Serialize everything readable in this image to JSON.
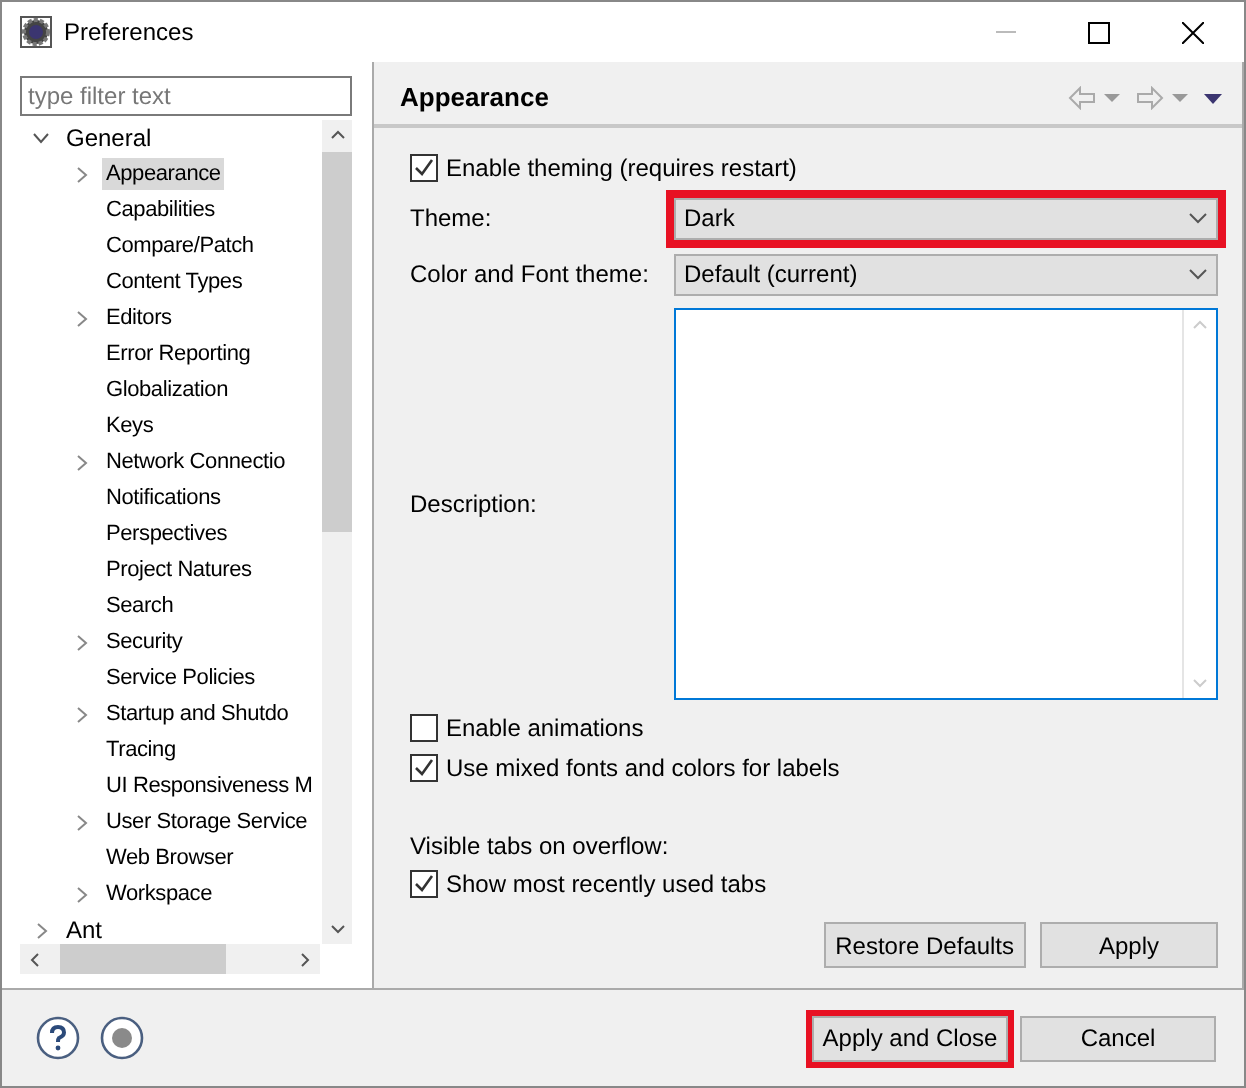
{
  "window": {
    "title": "Preferences"
  },
  "filter": {
    "placeholder": "type filter text"
  },
  "tree": [
    {
      "label": "General",
      "expanded": true,
      "expandable": true,
      "selected": false,
      "children": [
        {
          "label": "Appearance",
          "expandable": true,
          "selected": true
        },
        {
          "label": "Capabilities",
          "expandable": false,
          "selected": false
        },
        {
          "label": "Compare/Patch",
          "expandable": false,
          "selected": false
        },
        {
          "label": "Content Types",
          "expandable": false,
          "selected": false
        },
        {
          "label": "Editors",
          "expandable": true,
          "selected": false
        },
        {
          "label": "Error Reporting",
          "expandable": false,
          "selected": false
        },
        {
          "label": "Globalization",
          "expandable": false,
          "selected": false
        },
        {
          "label": "Keys",
          "expandable": false,
          "selected": false
        },
        {
          "label": "Network Connectio",
          "expandable": true,
          "selected": false
        },
        {
          "label": "Notifications",
          "expandable": false,
          "selected": false
        },
        {
          "label": "Perspectives",
          "expandable": false,
          "selected": false
        },
        {
          "label": "Project Natures",
          "expandable": false,
          "selected": false
        },
        {
          "label": "Search",
          "expandable": false,
          "selected": false
        },
        {
          "label": "Security",
          "expandable": true,
          "selected": false
        },
        {
          "label": "Service Policies",
          "expandable": false,
          "selected": false
        },
        {
          "label": "Startup and Shutdo",
          "expandable": true,
          "selected": false
        },
        {
          "label": "Tracing",
          "expandable": false,
          "selected": false
        },
        {
          "label": "UI Responsiveness M",
          "expandable": false,
          "selected": false
        },
        {
          "label": "User Storage Service",
          "expandable": true,
          "selected": false
        },
        {
          "label": "Web Browser",
          "expandable": false,
          "selected": false
        },
        {
          "label": "Workspace",
          "expandable": true,
          "selected": false
        }
      ]
    },
    {
      "label": "Ant",
      "expanded": false,
      "expandable": true,
      "selected": false
    }
  ],
  "page": {
    "title": "Appearance",
    "enable_theming": {
      "label": "Enable theming (requires restart)",
      "checked": true
    },
    "theme": {
      "label": "Theme:",
      "value": "Dark",
      "highlighted": true
    },
    "color_font_theme": {
      "label": "Color and Font theme:",
      "value": "Default (current)",
      "highlighted": false
    },
    "description": {
      "label": "Description:"
    },
    "options": [
      {
        "label": "Enable animations",
        "checked": false
      },
      {
        "label": "Use mixed fonts and colors for labels",
        "checked": true
      }
    ],
    "visible_tabs_label": "Visible tabs on overflow:",
    "tab_options": [
      {
        "label": "Show most recently used tabs",
        "checked": true
      }
    ],
    "buttons": [
      {
        "label": "Restore Defaults"
      },
      {
        "label": "Apply"
      }
    ]
  },
  "footer": {
    "buttons": [
      {
        "label": "Apply and Close",
        "highlighted": true
      },
      {
        "label": "Cancel",
        "highlighted": false
      }
    ]
  }
}
